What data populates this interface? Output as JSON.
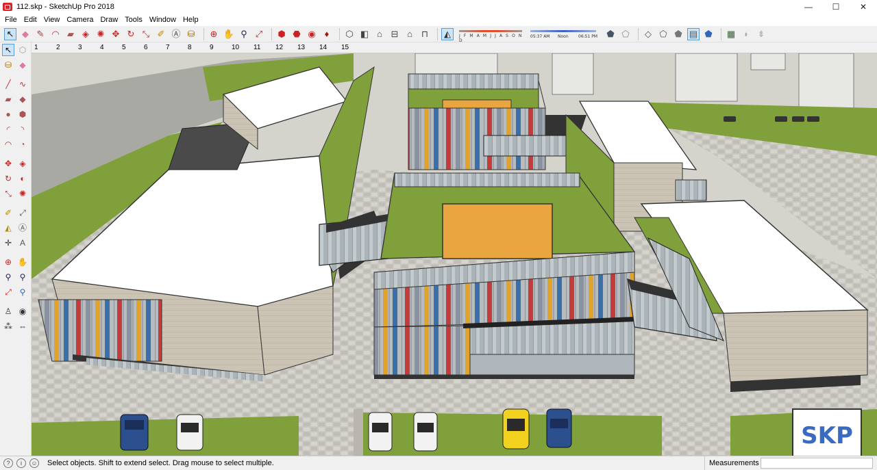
{
  "window": {
    "title": "112.skp - SketchUp Pro 2018",
    "minimize": "—",
    "maximize": "☐",
    "close": "✕"
  },
  "menu": [
    "File",
    "Edit",
    "View",
    "Camera",
    "Draw",
    "Tools",
    "Window",
    "Help"
  ],
  "shadow": {
    "months": "J F M A M J J A S O N D",
    "time_start": "05:37 AM",
    "time_mid": "Noon",
    "time_end": "06:51 PM"
  },
  "scenes": [
    "1",
    "2",
    "3",
    "4",
    "5",
    "6",
    "7",
    "8",
    "9",
    "10",
    "11",
    "12",
    "13",
    "14",
    "15"
  ],
  "status": {
    "hint": "Select objects. Shift to extend select. Drag mouse to select multiple.",
    "measurements_label": "Measurements"
  },
  "watermark": "SKP",
  "colors": {
    "accent": "#5a9bd5",
    "roof_court": "#e9a640",
    "grass": "#7fa03a",
    "roof": "#ffffff"
  }
}
